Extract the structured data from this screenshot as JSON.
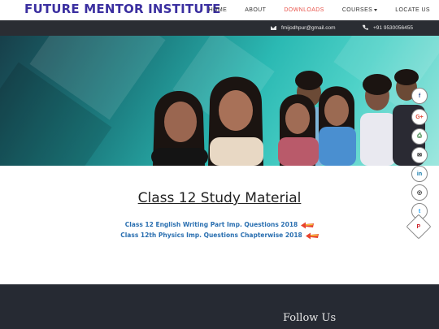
{
  "brand": {
    "name": "FUTURE MENTOR INSTITUTE"
  },
  "nav": {
    "items": [
      {
        "label": "HOME",
        "active": false
      },
      {
        "label": "ABOUT",
        "active": false
      },
      {
        "label": "DOWNLOADS",
        "active": true
      },
      {
        "label": "COURSES",
        "active": false,
        "dropdown": true
      },
      {
        "label": "LOCATE US",
        "active": false
      }
    ]
  },
  "topbar": {
    "email": "fmijodhpur@gmail.com",
    "phone": "+91 9530056455"
  },
  "content": {
    "heading": "Class 12 Study Material",
    "links": [
      {
        "label": "Class 12 English Writing Part Imp. Questions 2018"
      },
      {
        "label": "Class 12th Physics Imp. Questions Chapterwise 2018"
      }
    ]
  },
  "footer": {
    "follow": "Follow Us"
  },
  "social": {
    "icons": [
      "facebook-icon",
      "google-plus-icon",
      "print-icon",
      "email-icon",
      "linkedin-icon",
      "instagram-icon",
      "twitter-icon",
      "pinterest-icon"
    ],
    "labels": [
      "f",
      "G+",
      "⎙",
      "✉",
      "in",
      "◎",
      "t",
      "P"
    ]
  },
  "colors": {
    "brand": "#3b2fa0",
    "active_nav": "#e8534a",
    "link": "#2a6fb0",
    "topbar": "#2a2d33",
    "footer": "#262a33"
  }
}
